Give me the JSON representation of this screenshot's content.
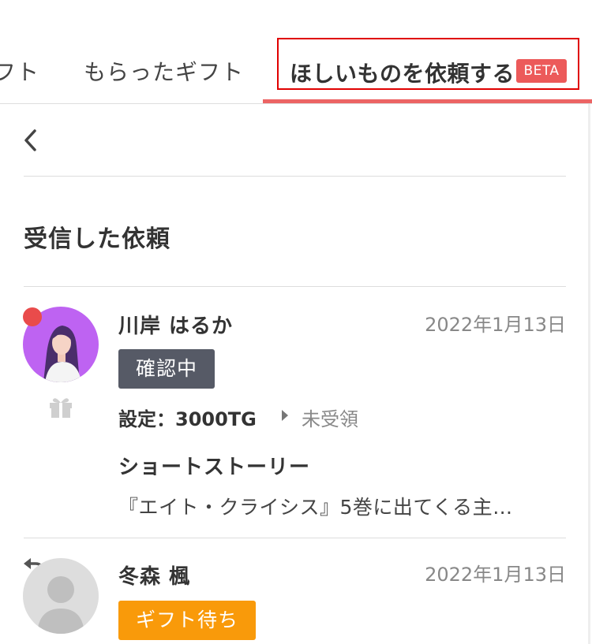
{
  "tabs": {
    "prev_label": "フト",
    "received_label": "もらったギフト",
    "request_label": "ほしいものを依頼する",
    "beta_label": "BETA"
  },
  "colors": {
    "accent_red": "#ec6464",
    "highlight_box": "#e00000",
    "unread_dot": "#e94b4b",
    "badge_confirming": "#565a66",
    "badge_waiting": "#f99a0a"
  },
  "icons": {
    "back": "chevron-left-icon",
    "gift": "gift-icon",
    "reply": "reply-icon"
  },
  "section": {
    "title": "受信した依頼"
  },
  "requests": [
    {
      "name": "川岸 はるか",
      "date": "2022年1月13日",
      "badge": "確認中",
      "setting": "設定：3000TG",
      "status": "未受領",
      "title": "ショートストーリー",
      "snippet": "『エイト・クライシス』5巻に出てくる主…",
      "unread": true
    },
    {
      "name": "冬森 楓",
      "date": "2022年1月13日",
      "badge": "ギフト待ち"
    }
  ]
}
